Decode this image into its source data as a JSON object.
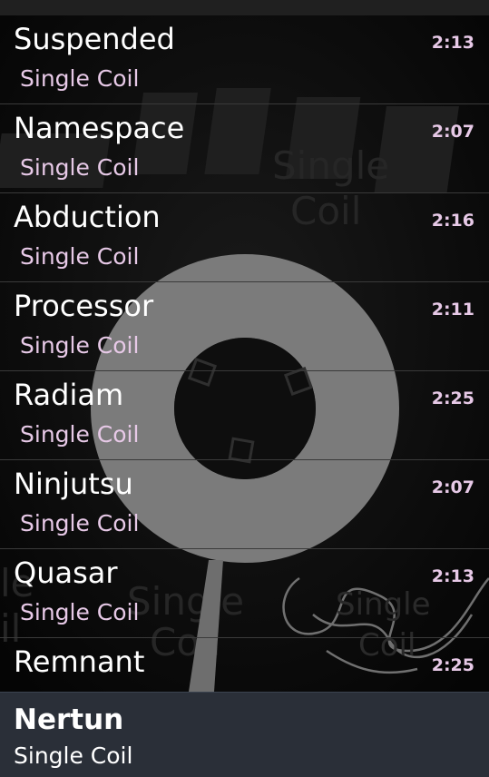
{
  "tracks": [
    {
      "title": "Suspended",
      "artist": "Single Coil",
      "duration": "2:13"
    },
    {
      "title": "Namespace",
      "artist": "Single Coil",
      "duration": "2:07"
    },
    {
      "title": "Abduction",
      "artist": "Single Coil",
      "duration": "2:16"
    },
    {
      "title": "Processor",
      "artist": "Single Coil",
      "duration": "2:11"
    },
    {
      "title": "Radiam",
      "artist": "Single Coil",
      "duration": "2:25"
    },
    {
      "title": "Ninjutsu",
      "artist": "Single Coil",
      "duration": "2:07"
    },
    {
      "title": "Quasar",
      "artist": "Single Coil",
      "duration": "2:13"
    },
    {
      "title": "Remnant",
      "duration": "2:25"
    }
  ],
  "now_playing": {
    "title": "Nertun",
    "artist": "Single Coil"
  },
  "colors": {
    "background": "#090909",
    "title_text": "#ffffff",
    "secondary_text": "#e7c9e7",
    "now_playing_bar": "#2a2f38"
  },
  "background_art": {
    "watermark_lettering": [
      "PEN",
      "Single Coil",
      "Single Coil",
      "Single Coil"
    ]
  }
}
